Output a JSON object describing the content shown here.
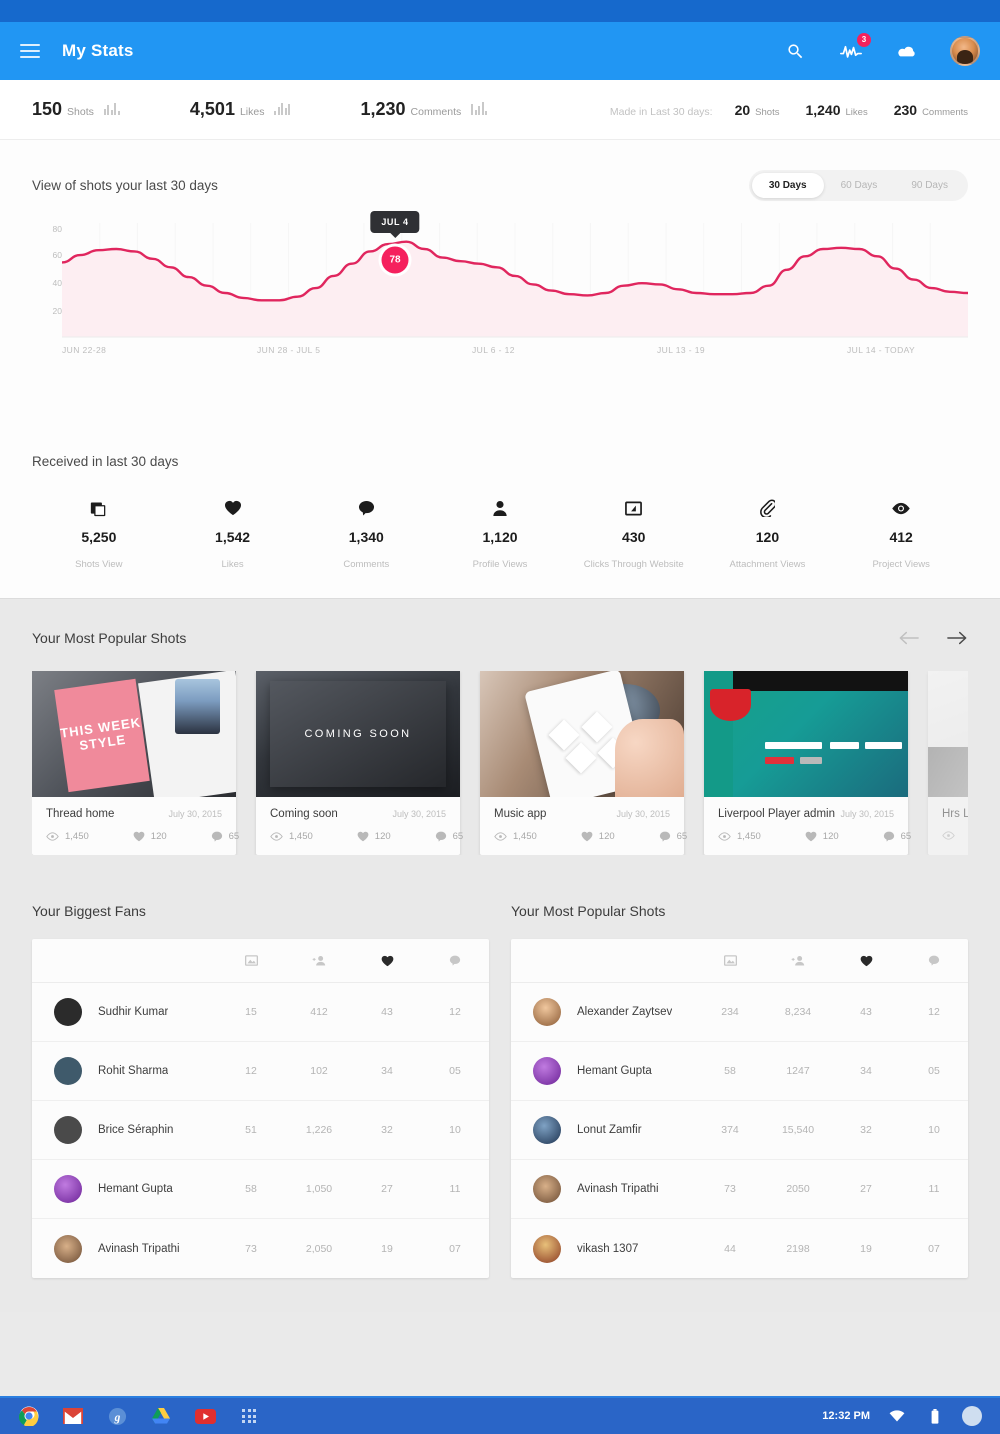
{
  "appbar": {
    "menu_icon": "hamburger-icon",
    "title": "My Stats",
    "search_icon": "search-icon",
    "activity_icon": "activity-pulse-icon",
    "activity_badge": "3",
    "cloud_icon": "cloud-icon",
    "avatar_icon": "user-avatar"
  },
  "statsbar": {
    "totals": [
      {
        "value": "150",
        "label": "Shots"
      },
      {
        "value": "4,501",
        "label": "Likes"
      },
      {
        "value": "1,230",
        "label": "Comments"
      }
    ],
    "made_label": "Made in Last 30 days:",
    "recent": [
      {
        "value": "20",
        "label": "Shots"
      },
      {
        "value": "1,240",
        "label": "Likes"
      },
      {
        "value": "230",
        "label": "Comments"
      }
    ]
  },
  "chart_section": {
    "title": "View of shots your last 30 days",
    "ranges": [
      {
        "label": "30 Days",
        "active": true
      },
      {
        "label": "60 Days",
        "active": false
      },
      {
        "label": "90 Days",
        "active": false
      }
    ]
  },
  "chart_data": {
    "type": "area",
    "title": "View of shots your last 30 days",
    "xlabel": "",
    "ylabel": "",
    "ylim": [
      0,
      90
    ],
    "yticks": [
      20,
      40,
      60,
      80
    ],
    "grid": true,
    "legend": "none",
    "accent_color": "#e0265e",
    "fill_color": "#fdeef2",
    "x_tick_labels": [
      "JUN  22-28",
      "JUN 28 - JUL 5",
      "JUL 6 - 12",
      "JUL 13 - 19",
      "JUL 14 - TODAY"
    ],
    "highlight": {
      "label": "JUL 4",
      "value": 78
    },
    "x": [
      1,
      2,
      3,
      4,
      5,
      6,
      7,
      8,
      9,
      10,
      11,
      12,
      13,
      14,
      15,
      16,
      17,
      18,
      19,
      20,
      21,
      22,
      23,
      24,
      25,
      26,
      27,
      28,
      29,
      30
    ],
    "values": [
      61,
      67,
      71,
      72,
      70,
      64,
      57,
      49,
      42,
      36,
      32,
      30,
      30,
      33,
      40,
      50,
      60,
      70,
      76,
      78,
      72,
      65,
      62,
      60,
      57,
      50,
      43,
      38,
      35,
      34,
      36,
      42,
      44,
      43,
      39,
      36,
      35,
      35,
      36,
      42,
      55,
      66,
      72,
      73,
      72,
      66,
      56,
      47,
      40,
      37,
      36
    ]
  },
  "received": {
    "title": "Received in last 30 days",
    "metrics": [
      {
        "icon": "shots-stack-icon",
        "value": "5,250",
        "label": "Shots View"
      },
      {
        "icon": "heart-icon",
        "value": "1,542",
        "label": "Likes"
      },
      {
        "icon": "comment-bubble-icon",
        "value": "1,340",
        "label": "Comments"
      },
      {
        "icon": "person-icon",
        "value": "1,120",
        "label": "Profile Views"
      },
      {
        "icon": "click-through-icon",
        "value": "430",
        "label": "Clicks Through Website"
      },
      {
        "icon": "paperclip-icon",
        "value": "120",
        "label": "Attachment Views"
      },
      {
        "icon": "eye-icon",
        "value": "412",
        "label": "Project Views"
      }
    ]
  },
  "carousel": {
    "title": "Your Most Popular Shots",
    "prev_icon": "arrow-left-icon",
    "next_icon": "arrow-right-icon",
    "cards": [
      {
        "name": "Thread home",
        "date": "July 30, 2015",
        "views": "1,450",
        "likes": "120",
        "comments": "65",
        "thumb": "th-thread",
        "thumb_text": "THIS WEEK STYLE"
      },
      {
        "name": "Coming soon",
        "date": "July 30, 2015",
        "views": "1,450",
        "likes": "120",
        "comments": "65",
        "thumb": "th-coming",
        "thumb_text": "COMING SOON"
      },
      {
        "name": "Music app",
        "date": "July 30, 2015",
        "views": "1,450",
        "likes": "120",
        "comments": "65",
        "thumb": "th-music",
        "thumb_text": ""
      },
      {
        "name": "Liverpool Player admin",
        "date": "July 30, 2015",
        "views": "1,450",
        "likes": "120",
        "comments": "65",
        "thumb": "th-liverpool",
        "thumb_text": ""
      },
      {
        "name": "Hrs L",
        "date": "",
        "views": "",
        "likes": "",
        "comments": "",
        "thumb": "th-partial",
        "thumb_text": ""
      }
    ]
  },
  "tables": {
    "column_icons": [
      "shots-icon",
      "add-person-icon",
      "heart-icon",
      "comment-icon"
    ],
    "fans": {
      "title": "Your Biggest Fans",
      "rows": [
        {
          "name": "Sudhir Kumar",
          "c1": "15",
          "c2": "412",
          "c3": "43",
          "c4": "12",
          "avatar": "#2b2b2b"
        },
        {
          "name": "Rohit Sharma",
          "c1": "12",
          "c2": "102",
          "c3": "34",
          "c4": "05",
          "avatar": "#3f5a6b"
        },
        {
          "name": "Brice Séraphin",
          "c1": "51",
          "c2": "1,226",
          "c3": "32",
          "c4": "10",
          "avatar": "#4a4a4a"
        },
        {
          "name": "Hemant Gupta",
          "c1": "58",
          "c2": "1,050",
          "c3": "27",
          "c4": "11",
          "avatar": "#7b2fa8"
        },
        {
          "name": "Avinash Tripathi",
          "c1": "73",
          "c2": "2,050",
          "c3": "19",
          "c4": "07",
          "avatar": "#8c6a4a"
        }
      ]
    },
    "shots": {
      "title": "Your Most Popular Shots",
      "rows": [
        {
          "name": "Alexander Zaytsev",
          "c1": "234",
          "c2": "8,234",
          "c3": "43",
          "c4": "12",
          "avatar": "#b9855e"
        },
        {
          "name": "Hemant Gupta",
          "c1": "58",
          "c2": "1247",
          "c3": "34",
          "c4": "05",
          "avatar": "#7b2fa8"
        },
        {
          "name": "Lonut Zamfir",
          "c1": "374",
          "c2": "15,540",
          "c3": "32",
          "c4": "10",
          "avatar": "#2d4a6b"
        },
        {
          "name": "Avinash Tripathi",
          "c1": "73",
          "c2": "2050",
          "c3": "27",
          "c4": "11",
          "avatar": "#8c6a4a"
        },
        {
          "name": "vikash 1307",
          "c1": "44",
          "c2": "2198",
          "c3": "19",
          "c4": "07",
          "avatar": "#b5452f"
        }
      ]
    }
  },
  "taskbar": {
    "apps": [
      "chrome-icon",
      "gmail-icon",
      "google-plus-icon",
      "google-drive-icon",
      "youtube-icon",
      "apps-grid-icon"
    ],
    "time": "12:32 PM",
    "wifi_icon": "wifi-icon",
    "battery_icon": "battery-icon",
    "avatar_icon": "user-avatar"
  }
}
